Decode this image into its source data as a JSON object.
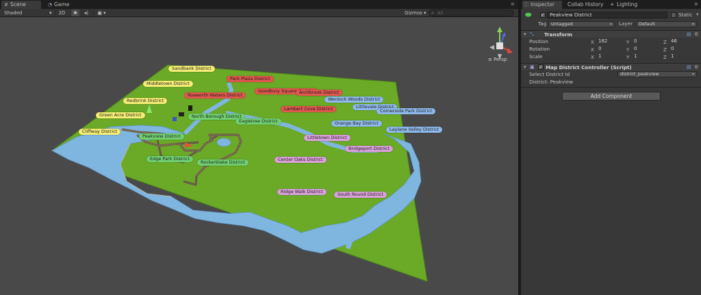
{
  "scene_tabs": [
    {
      "label": "Scene",
      "icon": "hash-icon"
    },
    {
      "label": "Game",
      "icon": "pacman-icon"
    }
  ],
  "toolbar": {
    "shading": "Shaded",
    "mode_2d": "2D",
    "gizmos": "Gizmos",
    "search_placeholder": "All"
  },
  "viewport": {
    "persp_label": "Persp",
    "colors": {
      "grass": "#6aaa26",
      "water": "#7fb6e0",
      "road": "#6b5a48"
    }
  },
  "districts": [
    {
      "name": "Sandbank District",
      "color": "yellow"
    },
    {
      "name": "Middletown District",
      "color": "yellow"
    },
    {
      "name": "Redbrink District",
      "color": "yellow"
    },
    {
      "name": "Green Acre District",
      "color": "yellow"
    },
    {
      "name": "Cliffway District",
      "color": "yellow"
    },
    {
      "name": "Park Plaza District",
      "color": "red"
    },
    {
      "name": "Goodbury Square District",
      "color": "red"
    },
    {
      "name": "Archbrook District",
      "color": "red"
    },
    {
      "name": "Rosworth Waters District",
      "color": "red"
    },
    {
      "name": "Lambert Cove District",
      "color": "red"
    },
    {
      "name": "Wenlock Woods District",
      "color": "blue"
    },
    {
      "name": "Littlevale District",
      "color": "blue"
    },
    {
      "name": "Comerside Park District",
      "color": "blue"
    },
    {
      "name": "Orange Bay District",
      "color": "blue"
    },
    {
      "name": "Laylane Valley District",
      "color": "blue"
    },
    {
      "name": "North Borough District",
      "color": "green"
    },
    {
      "name": "Eagletree District",
      "color": "green"
    },
    {
      "name": "Peakview District",
      "color": "green"
    },
    {
      "name": "Edge Park District",
      "color": "green"
    },
    {
      "name": "Rockerblake District",
      "color": "green"
    },
    {
      "name": "Littletown District",
      "color": "pink"
    },
    {
      "name": "Bridgeport District",
      "color": "pink"
    },
    {
      "name": "Center Oaks District",
      "color": "pink"
    },
    {
      "name": "Ridge Walk District",
      "color": "pink"
    },
    {
      "name": "South Round District",
      "color": "pink"
    }
  ],
  "inspector_tabs": [
    {
      "label": "Inspector",
      "icon": "info-icon"
    },
    {
      "label": "Collab History",
      "icon": ""
    },
    {
      "label": "Lighting",
      "icon": "lightbulb-icon"
    }
  ],
  "object": {
    "name": "Peakview District",
    "static_label": "Static",
    "tag_label": "Tag",
    "tag_value": "Untagged",
    "layer_label": "Layer",
    "layer_value": "Default"
  },
  "transform": {
    "title": "Transform",
    "rows": [
      {
        "label": "Position",
        "x": "182",
        "y": "0",
        "z": "46"
      },
      {
        "label": "Rotation",
        "x": "0",
        "y": "0",
        "z": "0"
      },
      {
        "label": "Scale",
        "x": "1",
        "y": "1",
        "z": "1"
      }
    ],
    "axes": {
      "x": "X",
      "y": "Y",
      "z": "Z"
    }
  },
  "controller": {
    "title": "Map District Controller (Script)",
    "select_label": "Select District Id",
    "select_value": "district_peakview",
    "district_text": "District: Peakview"
  },
  "add_component": "Add Component"
}
